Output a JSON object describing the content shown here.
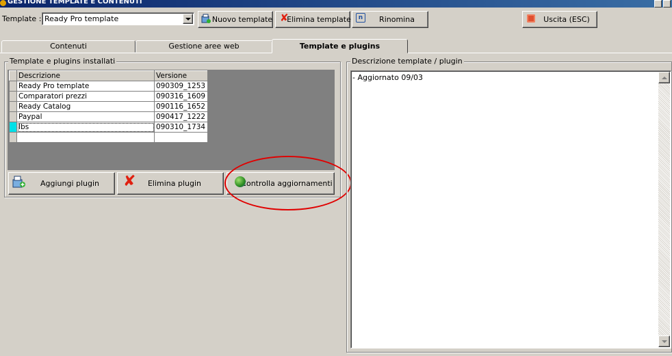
{
  "window": {
    "title": "GESTIONE TEMPLATE E CONTENUTI"
  },
  "toolbar": {
    "template_label": "Template :",
    "template_selected": "Ready Pro template",
    "new_template": "Nuovo template",
    "delete_template": "Elimina template",
    "rename": "Rinomina",
    "exit": "Uscita (ESC)"
  },
  "tabs": [
    {
      "label": "Contenuti"
    },
    {
      "label": "Gestione aree web"
    },
    {
      "label": "Template e plugins"
    }
  ],
  "installed": {
    "title": "Template e plugins installati",
    "columns": [
      "Descrizione",
      "Versione"
    ],
    "rows": [
      {
        "descrizione": "Ready Pro template",
        "versione": "090309_1253"
      },
      {
        "descrizione": "Comparatori prezzi",
        "versione": "090316_1609"
      },
      {
        "descrizione": "Ready Catalog",
        "versione": "090116_1652"
      },
      {
        "descrizione": "Paypal",
        "versione": "090417_1222"
      },
      {
        "descrizione": "Ibs",
        "versione": "090310_1734"
      }
    ],
    "buttons": {
      "add": "Aggiungi plugin",
      "delete": "Elimina plugin",
      "check_updates": "Controlla aggiornamenti"
    }
  },
  "description": {
    "title": "Descrizione template / plugin",
    "text": "- Aggiornato 09/03"
  }
}
